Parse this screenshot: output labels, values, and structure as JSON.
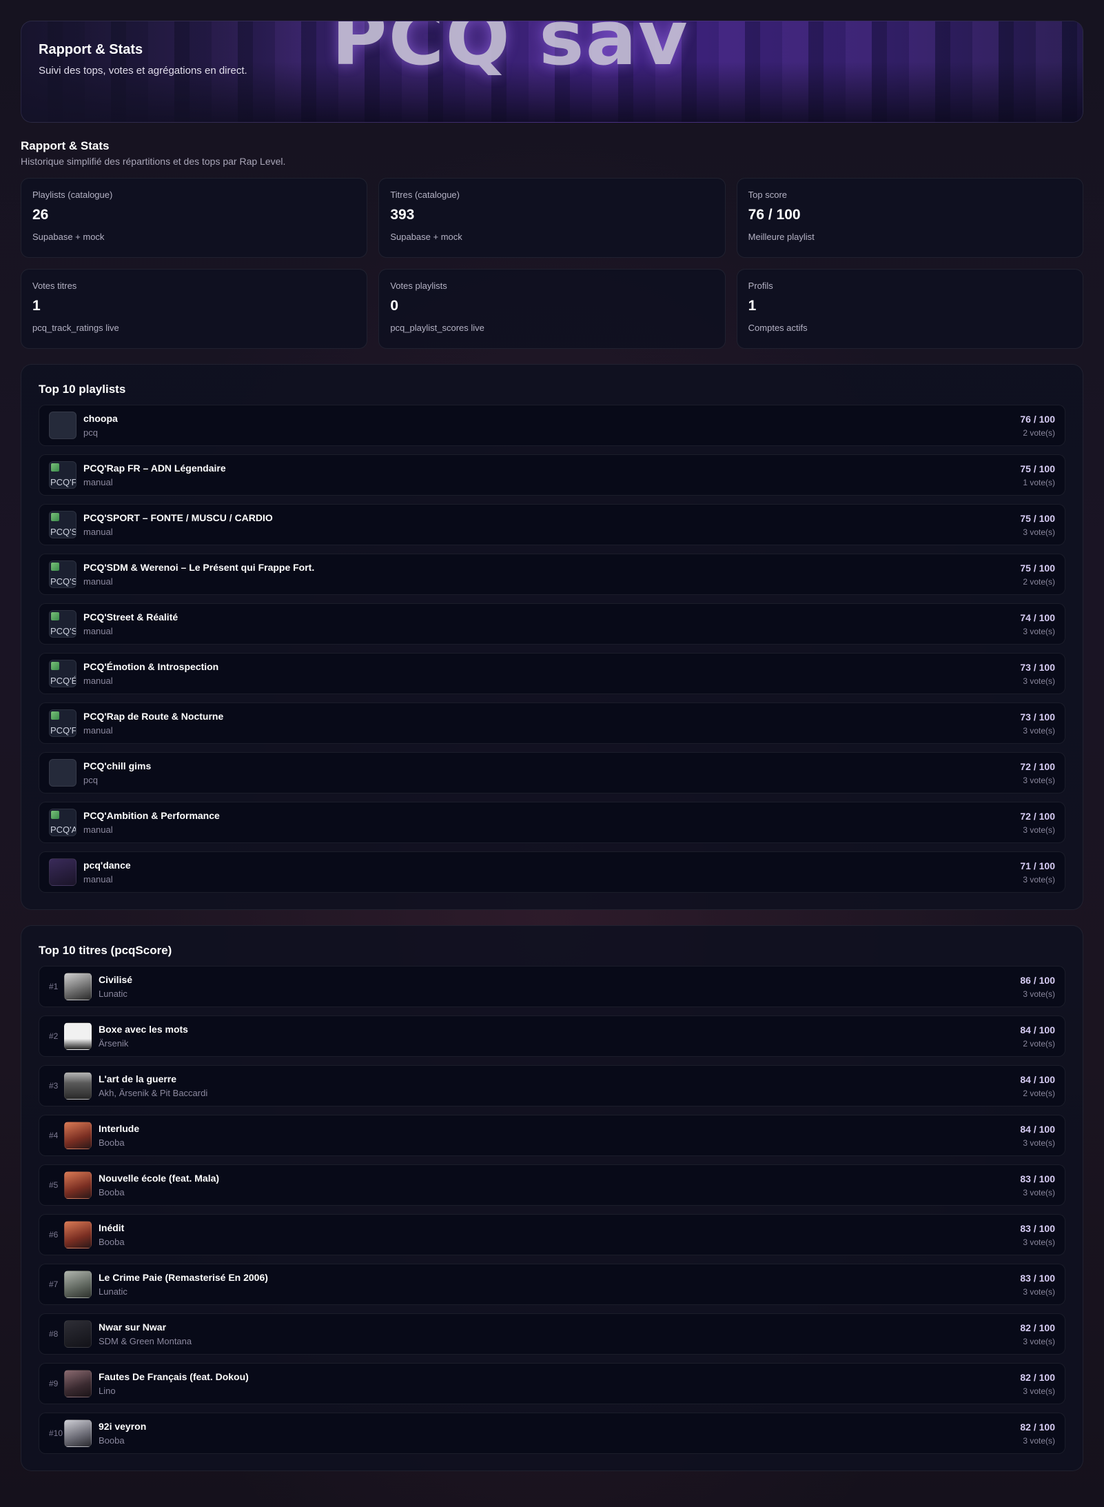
{
  "hero": {
    "title": "Rapport & Stats",
    "subtitle": "Suivi des tops, votes et agrégations en direct.",
    "banner_text": "PCQ sav"
  },
  "section": {
    "title": "Rapport & Stats",
    "subtitle": "Historique simplifié des répartitions et des tops par Rap Level."
  },
  "stats": [
    {
      "label": "Playlists (catalogue)",
      "value": "26",
      "note": "Supabase + mock"
    },
    {
      "label": "Titres (catalogue)",
      "value": "393",
      "note": "Supabase + mock"
    },
    {
      "label": "Top score",
      "value": "76 / 100",
      "note": "Meilleure playlist"
    },
    {
      "label": "Votes titres",
      "value": "1",
      "note": "pcq_track_ratings live"
    },
    {
      "label": "Votes playlists",
      "value": "0",
      "note": "pcq_playlist_scores live"
    },
    {
      "label": "Profils",
      "value": "1",
      "note": "Comptes actifs"
    }
  ],
  "top_playlists": {
    "title": "Top 10 playlists",
    "items": [
      {
        "name": "choopa",
        "source": "pcq",
        "score": "76 / 100",
        "votes": "2 vote(s)",
        "thumb": "empty",
        "alt": ""
      },
      {
        "name": "PCQ'Rap FR – ADN Légendaire",
        "source": "manual",
        "score": "75 / 100",
        "votes": "1 vote(s)",
        "thumb": "broken",
        "alt": "PCQ'F"
      },
      {
        "name": "PCQ'SPORT – FONTE / MUSCU / CARDIO",
        "source": "manual",
        "score": "75 / 100",
        "votes": "3 vote(s)",
        "thumb": "broken",
        "alt": "PCQ'S"
      },
      {
        "name": "PCQ'SDM & Werenoi – Le Présent qui Frappe Fort.",
        "source": "manual",
        "score": "75 / 100",
        "votes": "2 vote(s)",
        "thumb": "broken",
        "alt": "PCQ'S"
      },
      {
        "name": "PCQ'Street & Réalité",
        "source": "manual",
        "score": "74 / 100",
        "votes": "3 vote(s)",
        "thumb": "broken",
        "alt": "PCQ'S"
      },
      {
        "name": "PCQ'Émotion & Introspection",
        "source": "manual",
        "score": "73 / 100",
        "votes": "3 vote(s)",
        "thumb": "broken",
        "alt": "PCQ'É"
      },
      {
        "name": "PCQ'Rap de Route & Nocturne",
        "source": "manual",
        "score": "73 / 100",
        "votes": "3 vote(s)",
        "thumb": "broken",
        "alt": "PCQ'F"
      },
      {
        "name": "PCQ'chill gims",
        "source": "pcq",
        "score": "72 / 100",
        "votes": "3 vote(s)",
        "thumb": "empty",
        "alt": ""
      },
      {
        "name": "PCQ'Ambition & Performance",
        "source": "manual",
        "score": "72 / 100",
        "votes": "3 vote(s)",
        "thumb": "broken",
        "alt": "PCQ'A"
      },
      {
        "name": "pcq'dance",
        "source": "manual",
        "score": "71 / 100",
        "votes": "3 vote(s)",
        "thumb": "art",
        "alt": ""
      }
    ]
  },
  "top_tracks": {
    "title": "Top 10 titres (pcqScore)",
    "items": [
      {
        "rank": "#1",
        "name": "Civilisé",
        "artist": "Lunatic",
        "score": "86 / 100",
        "votes": "3 vote(s)",
        "cover": "c1"
      },
      {
        "rank": "#2",
        "name": "Boxe avec les mots",
        "artist": "Ärsenik",
        "score": "84 / 100",
        "votes": "2 vote(s)",
        "cover": "c2"
      },
      {
        "rank": "#3",
        "name": "L'art de la guerre",
        "artist": "Akh, Ärsenik & Pit Baccardi",
        "score": "84 / 100",
        "votes": "2 vote(s)",
        "cover": "c3"
      },
      {
        "rank": "#4",
        "name": "Interlude",
        "artist": "Booba",
        "score": "84 / 100",
        "votes": "3 vote(s)",
        "cover": "c4"
      },
      {
        "rank": "#5",
        "name": "Nouvelle école (feat. Mala)",
        "artist": "Booba",
        "score": "83 / 100",
        "votes": "3 vote(s)",
        "cover": "c4"
      },
      {
        "rank": "#6",
        "name": "Inédit",
        "artist": "Booba",
        "score": "83 / 100",
        "votes": "3 vote(s)",
        "cover": "c4"
      },
      {
        "rank": "#7",
        "name": "Le Crime Paie (Remasterisé En 2006)",
        "artist": "Lunatic",
        "score": "83 / 100",
        "votes": "3 vote(s)",
        "cover": "c5"
      },
      {
        "rank": "#8",
        "name": "Nwar sur Nwar",
        "artist": "SDM & Green Montana",
        "score": "82 / 100",
        "votes": "3 vote(s)",
        "cover": "c6"
      },
      {
        "rank": "#9",
        "name": "Fautes De Français (feat. Dokou)",
        "artist": "Lino",
        "score": "82 / 100",
        "votes": "3 vote(s)",
        "cover": "c7"
      },
      {
        "rank": "#10",
        "name": "92i veyron",
        "artist": "Booba",
        "score": "82 / 100",
        "votes": "3 vote(s)",
        "cover": "c8"
      }
    ]
  }
}
